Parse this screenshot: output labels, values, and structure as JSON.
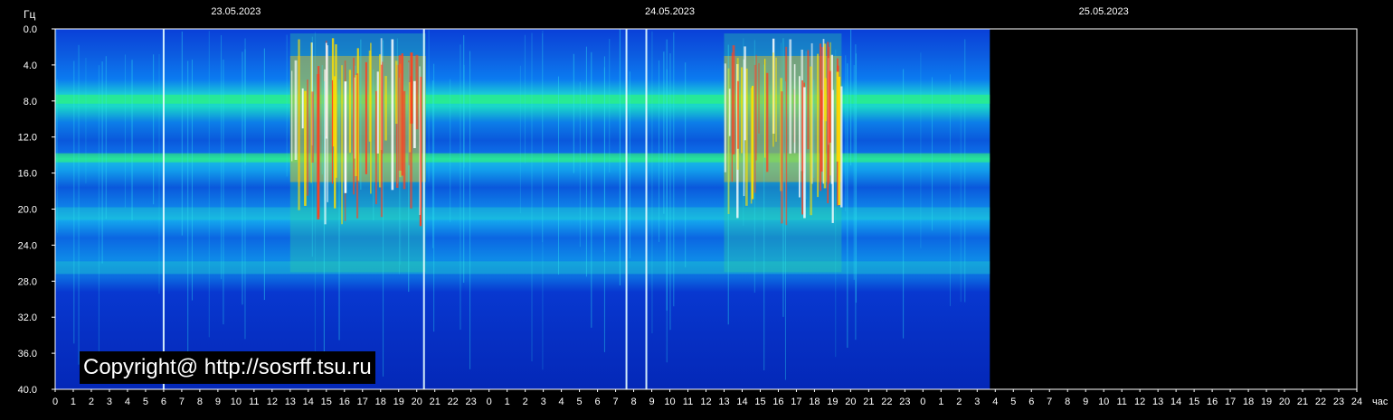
{
  "chart_data": {
    "type": "heatmap",
    "title": "",
    "ylabel": "Гц",
    "xlabel": "час",
    "ylim": [
      0,
      40
    ],
    "y_ticks": [
      "0.0",
      "4.0",
      "8.0",
      "12.0",
      "16.0",
      "20.0",
      "24.0",
      "28.0",
      "32.0",
      "36.0",
      "40.0"
    ],
    "x_ticks": [
      "0",
      "1",
      "2",
      "3",
      "4",
      "5",
      "6",
      "7",
      "8",
      "9",
      "10",
      "11",
      "12",
      "13",
      "14",
      "15",
      "16",
      "17",
      "18",
      "19",
      "20",
      "21",
      "22",
      "23",
      "0",
      "1",
      "2",
      "3",
      "4",
      "5",
      "6",
      "7",
      "8",
      "9",
      "10",
      "11",
      "12",
      "13",
      "14",
      "15",
      "16",
      "17",
      "18",
      "19",
      "20",
      "21",
      "22",
      "23",
      "0",
      "1",
      "2",
      "3",
      "4",
      "5",
      "6",
      "7",
      "8",
      "9",
      "10",
      "11",
      "12",
      "13",
      "14",
      "15",
      "16",
      "17",
      "18",
      "19",
      "20",
      "21",
      "22",
      "23",
      "24"
    ],
    "dates": [
      "23.05.2023",
      "24.05.2023",
      "25.05.2023"
    ],
    "data_end_hour": 51.7,
    "resonance_bands_hz": [
      7.8,
      14.3,
      20.5,
      26.5
    ],
    "intense_periods_hours": [
      [
        13,
        20.5
      ],
      [
        37,
        43.5
      ]
    ],
    "bright_vertical_lines_hours": [
      6,
      20.4,
      31.6,
      32.7
    ],
    "grid": false,
    "colormap": [
      "#000060",
      "#0030ff",
      "#00d0ff",
      "#00ff60",
      "#ffff00",
      "#ff3000",
      "#ffffff"
    ]
  },
  "copyright": "Copyright@ http://sosrff.tsu.ru"
}
